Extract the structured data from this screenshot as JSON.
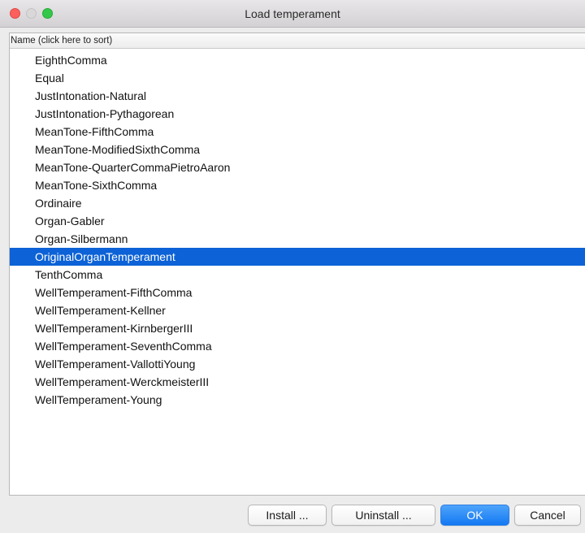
{
  "window": {
    "title": "Load temperament"
  },
  "list": {
    "column_header": "Name (click here to sort)",
    "selected_index": 11,
    "items": [
      "EighthComma",
      "Equal",
      "JustIntonation-Natural",
      "JustIntonation-Pythagorean",
      "MeanTone-FifthComma",
      "MeanTone-ModifiedSixthComma",
      "MeanTone-QuarterCommaPietroAaron",
      "MeanTone-SixthComma",
      "Ordinaire",
      "Organ-Gabler",
      "Organ-Silbermann",
      "OriginalOrganTemperament",
      "TenthComma",
      "WellTemperament-FifthComma",
      "WellTemperament-Kellner",
      "WellTemperament-KirnbergerIII",
      "WellTemperament-SeventhComma",
      "WellTemperament-VallottiYoung",
      "WellTemperament-WerckmeisterIII",
      "WellTemperament-Young"
    ]
  },
  "buttons": {
    "install": "Install ...",
    "uninstall": "Uninstall ...",
    "ok": "OK",
    "cancel": "Cancel"
  },
  "colors": {
    "selection": "#0c62d6",
    "primary_button": "#1378f2",
    "close_light": "#fc605c",
    "maximize_light": "#34c84a"
  }
}
